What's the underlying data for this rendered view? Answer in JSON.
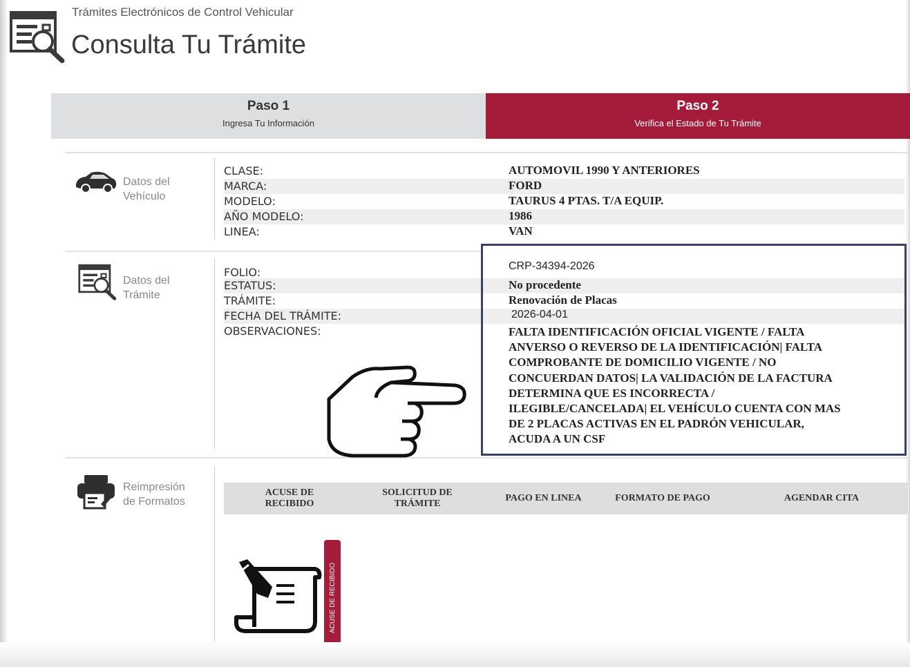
{
  "header": {
    "subtitle": "Trámites Electrónicos de Control Vehicular",
    "title": "Consulta Tu Trámite"
  },
  "steps": [
    {
      "title": "Paso 1",
      "subtitle": "Ingresa Tu Información",
      "color": "#dedfe1"
    },
    {
      "title": "Paso 2",
      "subtitle": "Verifica el Estado de Tu Trámite",
      "color": "#a51c3a"
    }
  ],
  "vehiculo": {
    "label_line1": "Datos del",
    "label_line2": "Vehículo",
    "icon": "car-icon",
    "fields": [
      {
        "label": "CLASE:",
        "value": "AUTOMOVIL 1990 Y ANTERIORES"
      },
      {
        "label": "MARCA:",
        "value": "FORD"
      },
      {
        "label": "MODELO:",
        "value": "TAURUS 4 PTAS. T/A EQUIP."
      },
      {
        "label": "AÑO MODELO:",
        "value": "1986"
      },
      {
        "label": "LINEA:",
        "value": "VAN"
      }
    ]
  },
  "tramite": {
    "label_line1": "Datos del",
    "label_line2": "Trámite",
    "icon": "document-search-icon",
    "fields": [
      {
        "label": "FOLIO:",
        "value": "CRP-34394-2026"
      },
      {
        "label": "ESTATUS:",
        "value": "No procedente"
      },
      {
        "label": "TRÁMITE:",
        "value": "Renovación de Placas"
      },
      {
        "label": "FECHA DEL TRÁMITE:",
        "value": "2026-04-01"
      },
      {
        "label": "OBSERVACIONES:",
        "value": ""
      }
    ],
    "observaciones": [
      "FALTA IDENTIFICACIÓN OFICIAL VIGENTE / FALTA",
      "ANVERSO O REVERSO DE LA IDENTIFICACIÓN| FALTA",
      "COMPROBANTE DE DOMICILIO VIGENTE / NO",
      "CONCUERDAN DATOS| LA VALIDACIÓN DE LA FACTURA",
      "DETERMINA QUE ES INCORRECTA /",
      "ILEGIBLE/CANCELADA| EL VEHÍCULO CUENTA CON MAS",
      "DE 2 PLACAS ACTIVAS EN EL PADRÓN VEHICULAR,",
      "ACUDA A UN CSF"
    ],
    "highlight_color": "#3b3f64"
  },
  "formatos": {
    "label_line1": "Reimpresión",
    "label_line2": "de Formatos",
    "icon": "printer-icon",
    "columns": [
      {
        "line1": "ACUSE DE",
        "line2": "RECIBIDO"
      },
      {
        "line1": "SOLICITUD DE",
        "line2": "TRÁMITE"
      },
      {
        "line1": "PAGO EN LINEA",
        "line2": ""
      },
      {
        "line1": "FORMATO DE PAGO",
        "line2": ""
      },
      {
        "line1": "AGENDAR CITA",
        "line2": ""
      }
    ],
    "acuse_tab": "ACUSE DE RECIBIDO",
    "acuse_icon": "signed-document-icon"
  },
  "pointer_icon": "pointing-hand-icon"
}
